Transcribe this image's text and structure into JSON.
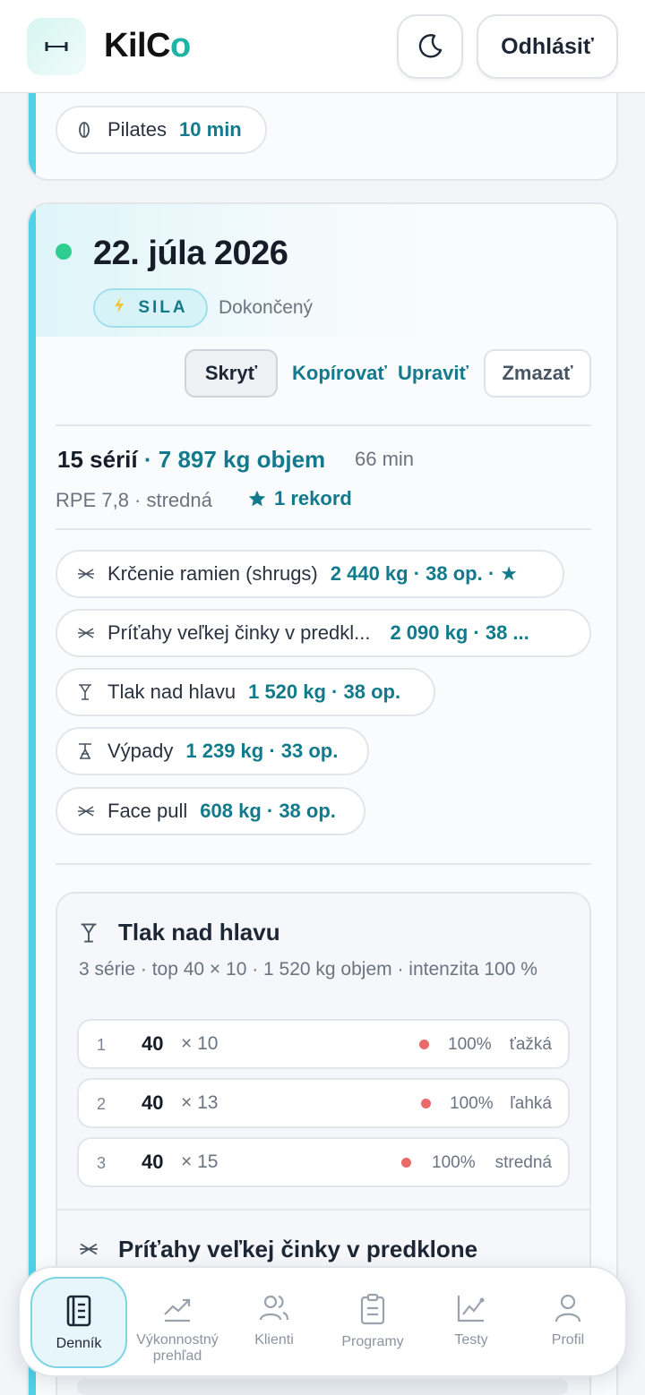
{
  "header": {
    "brand_main": "KilC",
    "brand_accent": "o",
    "logout_label": "Odhlásiť",
    "logo_icon": "dumbbell-icon",
    "theme_icon": "moon-icon"
  },
  "prev_card": {
    "pill": {
      "name": "Pilates",
      "stat": "10 min",
      "icon": "pilates-icon"
    }
  },
  "workout": {
    "date": "22. júla 2026",
    "type_badge": "SILA",
    "status": "Dokončený",
    "actions": {
      "hide": "Skryť",
      "copy": "Kopírovať",
      "edit": "Upraviť",
      "delete": "Zmazať"
    },
    "summary": {
      "sets": "15 sérií",
      "volume": "· 7 897 kg objem",
      "duration": "66 min",
      "rpe": "RPE 7,8 · stredná",
      "records": "1 rekord"
    },
    "exercises": [
      {
        "name": "Krčenie ramien (shrugs)",
        "stat": "2 440 kg · 38 op. · ★"
      },
      {
        "name": "Príťahy veľkej činky v predkl...",
        "stat": "2 090 kg · 38 ..."
      },
      {
        "name": "Tlak nad hlavu",
        "stat": "1 520 kg · 38 op."
      },
      {
        "name": "Výpady",
        "stat": "1 239 kg · 33 op."
      },
      {
        "name": "Face pull",
        "stat": "608 kg · 38 op."
      }
    ],
    "detail": {
      "title": "Tlak nad hlavu",
      "subtitle": "3 série · top 40 × 10 · 1 520 kg objem · intenzita 100 %",
      "sets": [
        {
          "n": "1",
          "weight": "40",
          "reps": "× 10",
          "pct": "100%",
          "difficulty": "ťažká"
        },
        {
          "n": "2",
          "weight": "40",
          "reps": "× 13",
          "pct": "100%",
          "difficulty": "ľahká"
        },
        {
          "n": "3",
          "weight": "40",
          "reps": "× 15",
          "pct": "100%",
          "difficulty": "stredná"
        }
      ],
      "next_title": "Príťahy veľkej činky v predklone"
    }
  },
  "nav": [
    {
      "label": "Denník",
      "icon": "journal-icon",
      "active": true
    },
    {
      "label": "Výkonnostný prehľad",
      "icon": "trend-icon",
      "active": false
    },
    {
      "label": "Klienti",
      "icon": "users-icon",
      "active": false
    },
    {
      "label": "Programy",
      "icon": "clipboard-icon",
      "active": false
    },
    {
      "label": "Testy",
      "icon": "chart-icon",
      "active": false
    },
    {
      "label": "Profil",
      "icon": "person-icon",
      "active": false
    }
  ],
  "colors": {
    "accent": "#127a8c",
    "stripe": "#4fd2e8",
    "done_dot": "#2fce8f",
    "intensity_dot": "#ea6a6a",
    "brand_accent": "#1fb2a5"
  }
}
